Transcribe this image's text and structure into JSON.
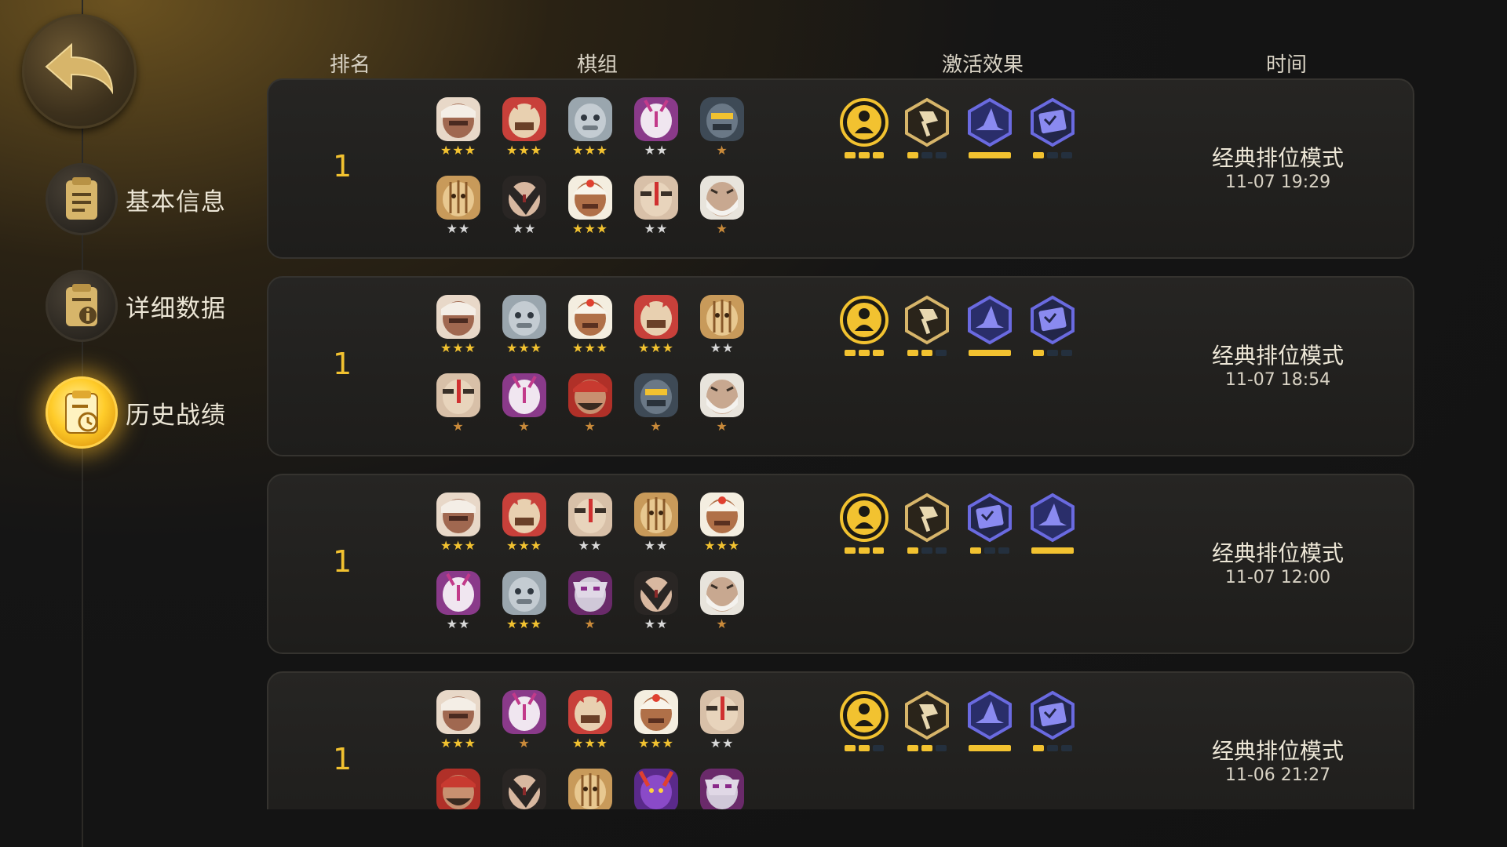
{
  "headers": {
    "rank": "排名",
    "lineup": "棋组",
    "synergy": "激活效果",
    "time": "时间"
  },
  "nav": [
    {
      "label": "基本信息",
      "icon": "notes-icon",
      "active": false
    },
    {
      "label": "详细数据",
      "icon": "info-icon",
      "active": false
    },
    {
      "label": "历史战绩",
      "icon": "history-clock-icon",
      "active": true
    }
  ],
  "colors": {
    "accent": "#f2c230",
    "synergy_blue": "#5a5ad8",
    "synergy_gold": "#f2c230"
  },
  "matches": [
    {
      "rank": "1",
      "mode": "经典排位模式",
      "time": "11-07 19:29",
      "pieces": [
        {
          "name": "white-hair-warrior",
          "stars": 3
        },
        {
          "name": "red-hood-mask",
          "stars": 3
        },
        {
          "name": "grey-beast",
          "stars": 3
        },
        {
          "name": "white-mask-demon",
          "stars": 2
        },
        {
          "name": "robot-head",
          "stars": 1
        },
        {
          "name": "tree-spirit",
          "stars": 2
        },
        {
          "name": "dark-hair-swordsman",
          "stars": 2
        },
        {
          "name": "turban-merchant",
          "stars": 3
        },
        {
          "name": "eyepatch-bandit",
          "stars": 2
        },
        {
          "name": "old-wizard",
          "stars": 1
        }
      ],
      "synergies": [
        {
          "icon": "gold-emblem-icon",
          "bars": [
            1,
            1,
            1
          ]
        },
        {
          "icon": "axe-badge-icon",
          "bars": [
            1,
            0,
            0
          ]
        },
        {
          "icon": "witch-hat-icon",
          "bars": "full"
        },
        {
          "icon": "spellbook-icon",
          "bars": [
            1,
            0,
            0
          ]
        }
      ]
    },
    {
      "rank": "1",
      "mode": "经典排位模式",
      "time": "11-07 18:54",
      "pieces": [
        {
          "name": "white-hair-warrior",
          "stars": 3
        },
        {
          "name": "grey-beast",
          "stars": 3
        },
        {
          "name": "turban-merchant",
          "stars": 3
        },
        {
          "name": "red-hood-mask",
          "stars": 3
        },
        {
          "name": "tree-spirit",
          "stars": 2
        },
        {
          "name": "eyepatch-bandit",
          "stars": 1
        },
        {
          "name": "white-mask-demon",
          "stars": 1
        },
        {
          "name": "red-bandana-pirate",
          "stars": 1
        },
        {
          "name": "robot-head",
          "stars": 1
        },
        {
          "name": "old-wizard",
          "stars": 1
        }
      ],
      "synergies": [
        {
          "icon": "gold-emblem-icon",
          "bars": [
            1,
            1,
            1
          ]
        },
        {
          "icon": "axe-badge-icon",
          "bars": [
            1,
            1,
            0
          ]
        },
        {
          "icon": "witch-hat-icon",
          "bars": "full"
        },
        {
          "icon": "spellbook-icon",
          "bars": [
            1,
            0,
            0
          ]
        }
      ]
    },
    {
      "rank": "1",
      "mode": "经典排位模式",
      "time": "11-07 12:00",
      "pieces": [
        {
          "name": "white-hair-warrior",
          "stars": 3
        },
        {
          "name": "red-hood-mask",
          "stars": 3
        },
        {
          "name": "eyepatch-bandit",
          "stars": 2
        },
        {
          "name": "tree-spirit",
          "stars": 2
        },
        {
          "name": "turban-merchant",
          "stars": 3
        },
        {
          "name": "white-mask-demon",
          "stars": 2
        },
        {
          "name": "grey-beast",
          "stars": 3
        },
        {
          "name": "purple-mask-assassin",
          "stars": 1
        },
        {
          "name": "dark-hair-swordsman",
          "stars": 2
        },
        {
          "name": "old-wizard",
          "stars": 1
        }
      ],
      "synergies": [
        {
          "icon": "gold-emblem-icon",
          "bars": [
            1,
            1,
            1
          ]
        },
        {
          "icon": "axe-badge-icon",
          "bars": [
            1,
            0,
            0
          ]
        },
        {
          "icon": "spellbook-icon",
          "bars": [
            1,
            0,
            0
          ]
        },
        {
          "icon": "witch-hat-icon",
          "bars": "full"
        }
      ]
    },
    {
      "rank": "1",
      "mode": "经典排位模式",
      "time": "11-06 21:27",
      "pieces": [
        {
          "name": "white-hair-warrior",
          "stars": 3
        },
        {
          "name": "white-mask-demon",
          "stars": 1
        },
        {
          "name": "red-hood-mask",
          "stars": 3
        },
        {
          "name": "turban-merchant",
          "stars": 3
        },
        {
          "name": "eyepatch-bandit",
          "stars": 2
        },
        {
          "name": "red-bandana-pirate",
          "stars": 0
        },
        {
          "name": "dark-hair-swordsman",
          "stars": 0
        },
        {
          "name": "tree-spirit",
          "stars": 0
        },
        {
          "name": "horned-purple-demon",
          "stars": 0
        },
        {
          "name": "purple-mask-assassin",
          "stars": 0
        }
      ],
      "synergies": [
        {
          "icon": "gold-emblem-icon",
          "bars": [
            1,
            1,
            0
          ]
        },
        {
          "icon": "axe-badge-icon",
          "bars": [
            1,
            1,
            0
          ]
        },
        {
          "icon": "witch-hat-icon",
          "bars": "full"
        },
        {
          "icon": "spellbook-icon",
          "bars": [
            1,
            0,
            0
          ]
        }
      ]
    }
  ]
}
